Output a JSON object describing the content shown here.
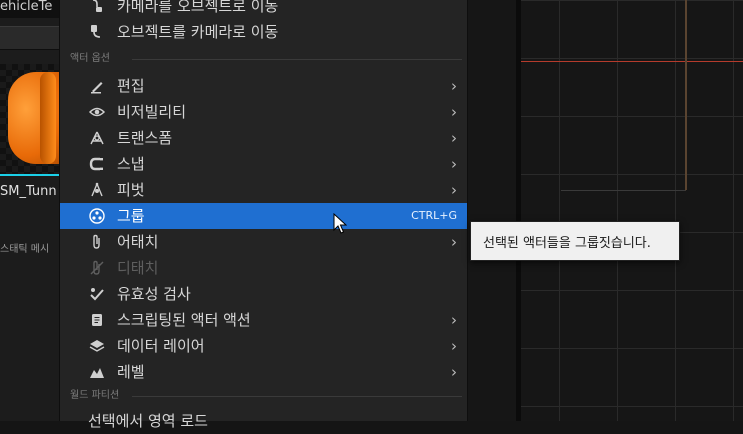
{
  "left_panel": {
    "title_fragment": "ehicleTe",
    "asset_name": "SM_Tunn",
    "asset_type": "스태틱 메시"
  },
  "menu": {
    "items_top": [
      {
        "label": "카메라를 오브젝트로 이동",
        "icon": "camera-to-object-icon"
      },
      {
        "label": "오브젝트를 카메라로 이동",
        "icon": "object-to-camera-icon"
      }
    ],
    "section_actor": "액터 옵션",
    "items": [
      {
        "label": "편집",
        "icon": "edit-icon",
        "submenu": true
      },
      {
        "label": "비저빌리티",
        "icon": "visibility-icon",
        "submenu": true
      },
      {
        "label": "트랜스폼",
        "icon": "transform-icon",
        "submenu": true
      },
      {
        "label": "스냅",
        "icon": "snap-icon",
        "submenu": true
      },
      {
        "label": "피벗",
        "icon": "pivot-icon",
        "submenu": true
      },
      {
        "label": "그룹",
        "icon": "group-icon",
        "shortcut": "CTRL+G",
        "highlighted": true
      },
      {
        "label": "어태치",
        "icon": "attach-icon",
        "submenu": true
      },
      {
        "label": "디태치",
        "icon": "detach-icon",
        "disabled": true
      },
      {
        "label": "유효성 검사",
        "icon": "validate-icon"
      },
      {
        "label": "스크립팅된 액터 액션",
        "icon": "script-icon",
        "submenu": true
      },
      {
        "label": "데이터 레이어",
        "icon": "layers-icon",
        "submenu": true
      },
      {
        "label": "레벨",
        "icon": "level-icon",
        "submenu": true
      }
    ],
    "section_world": "월드 파티션",
    "item_bottom": "선택에서 영역 로드"
  },
  "tooltip": {
    "text": "선택된 액터들을 그룹짓습니다."
  },
  "colors": {
    "highlight": "#1f6fd1",
    "menu_bg": "#242424",
    "accent_orange": "#e86a08",
    "accent_cyan": "#1bd0e8"
  }
}
